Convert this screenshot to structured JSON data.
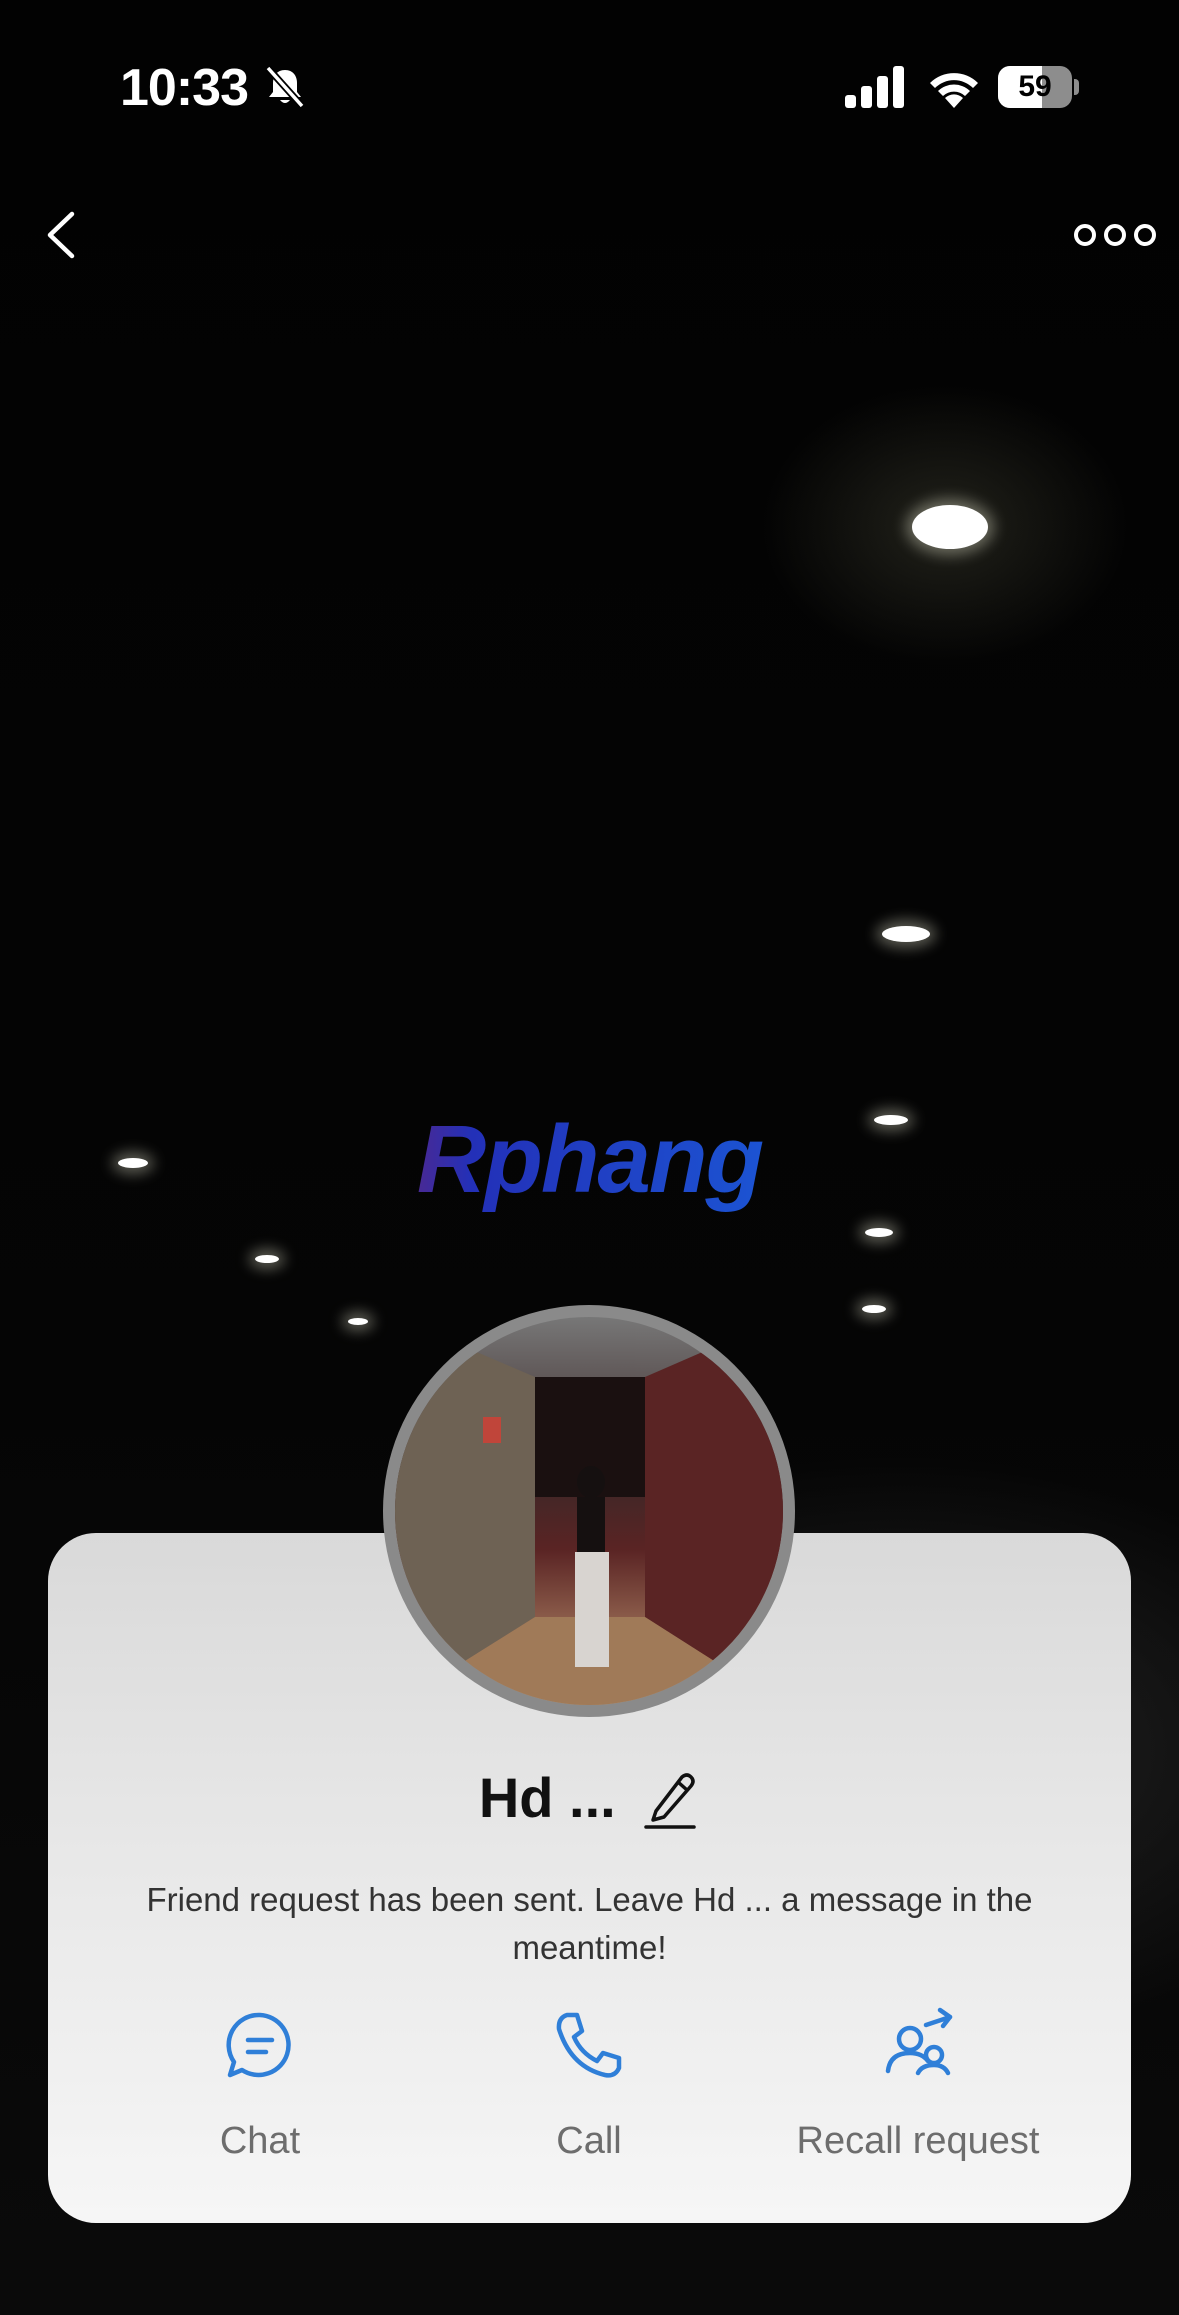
{
  "status_bar": {
    "time": "10:33",
    "battery": "59",
    "battery_level": 0.59
  },
  "watermark": "Rphang",
  "profile": {
    "name": "Hd ...",
    "message": "Friend request has been sent. Leave Hd ... a message in the meantime!"
  },
  "actions": [
    {
      "label": "Chat",
      "icon": "chat-bubble-icon"
    },
    {
      "label": "Call",
      "icon": "phone-icon"
    },
    {
      "label": "Recall request",
      "icon": "recall-request-icon"
    }
  ],
  "colors": {
    "accent": "#2f7fd8",
    "card": "#ececec",
    "label": "#6d6d6d"
  }
}
